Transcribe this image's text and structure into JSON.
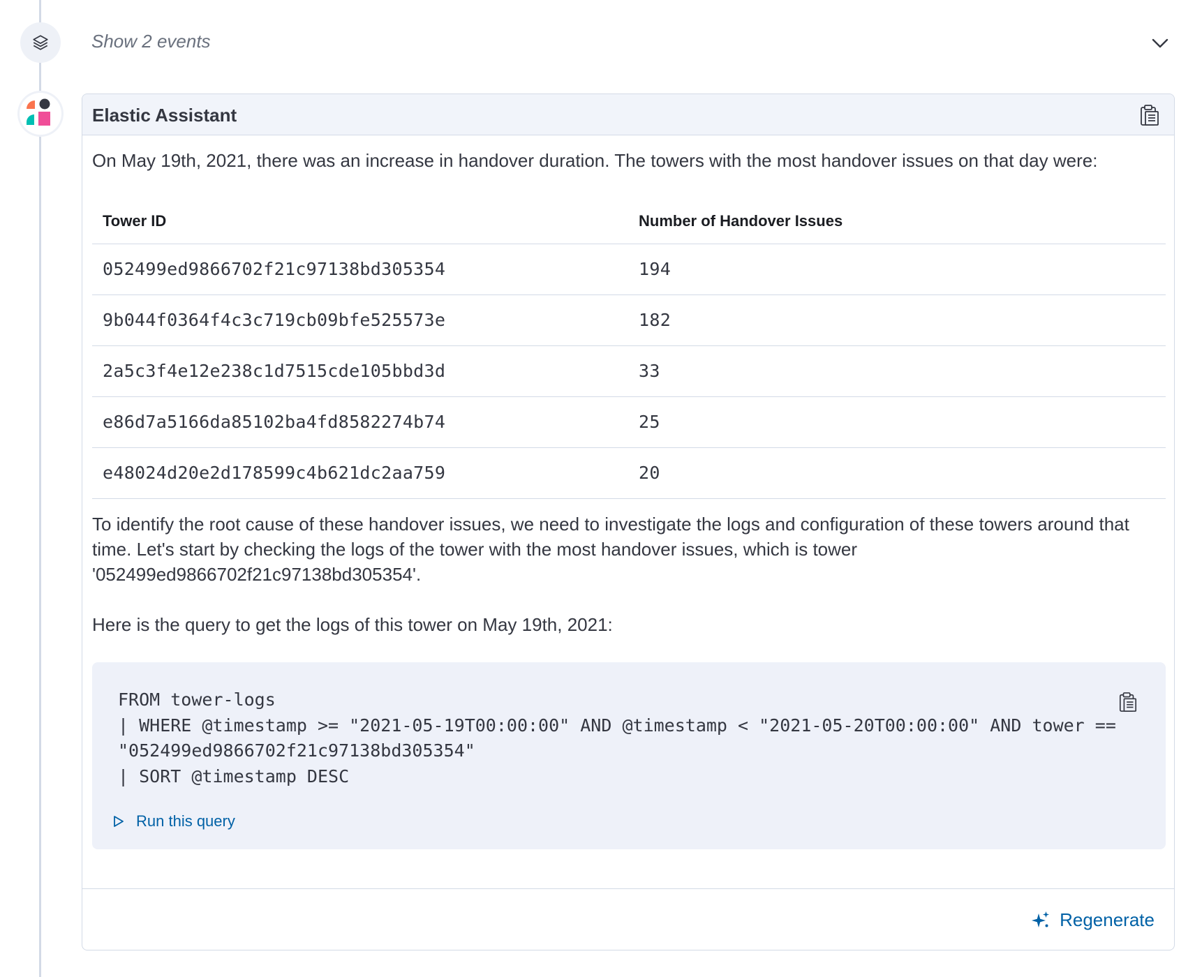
{
  "events": {
    "label": "Show 2 events"
  },
  "assistant": {
    "title": "Elastic Assistant",
    "intro": "On May 19th, 2021, there was an increase in handover duration. The towers with the most handover issues on that day were:",
    "table": {
      "headers": [
        "Tower ID",
        "Number of Handover Issues"
      ],
      "rows": [
        [
          "052499ed9866702f21c97138bd305354",
          "194"
        ],
        [
          "9b044f0364f4c3c719cb09bfe525573e",
          "182"
        ],
        [
          "2a5c3f4e12e238c1d7515cde105bbd3d",
          "33"
        ],
        [
          "e86d7a5166da85102ba4fd8582274b74",
          "25"
        ],
        [
          "e48024d20e2d178599c4b621dc2aa759",
          "20"
        ]
      ]
    },
    "paragraph2": "To identify the root cause of these handover issues, we need to investigate the logs and configuration of these towers around that time. Let's start by checking the logs of the tower with the most handover issues, which is tower '052499ed9866702f21c97138bd305354'.",
    "paragraph3": "Here is the query to get the logs of this tower on May 19th, 2021:",
    "code": "FROM tower-logs\n| WHERE @timestamp >= \"2021-05-19T00:00:00\" AND @timestamp < \"2021-05-20T00:00:00\" AND tower ==\n\"052499ed9866702f21c97138bd305354\"\n| SORT @timestamp DESC",
    "run_query_label": "Run this query",
    "regenerate_label": "Regenerate"
  },
  "colors": {
    "accent": "#0061a6",
    "header_bg": "#f1f4fa",
    "code_bg": "#eef1f9",
    "border": "#d3dae6"
  },
  "icons": {
    "events": "layers-icon",
    "expand": "chevron-down-icon",
    "avatar": "elastic-assistant-logo",
    "copy": "clipboard-icon",
    "run": "play-icon",
    "regenerate": "sparkles-icon"
  }
}
